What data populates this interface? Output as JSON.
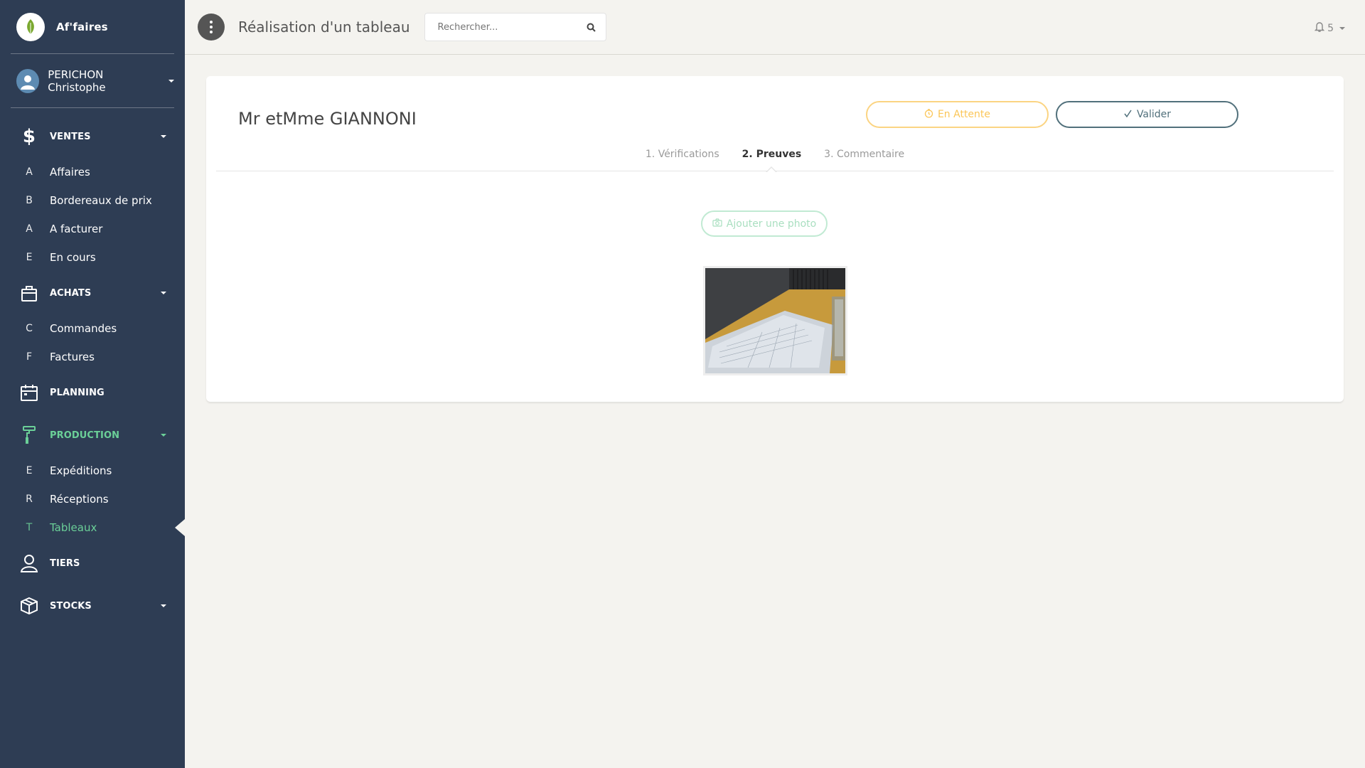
{
  "brand": {
    "name": "Af'faires"
  },
  "user": {
    "name": "PERICHON Christophe"
  },
  "nav": {
    "ventes": {
      "label": "VENTES",
      "items": [
        {
          "mini": "A",
          "label": "Affaires"
        },
        {
          "mini": "B",
          "label": "Bordereaux de prix"
        },
        {
          "mini": "A",
          "label": "A facturer"
        },
        {
          "mini": "E",
          "label": "En cours"
        }
      ]
    },
    "achats": {
      "label": "ACHATS",
      "items": [
        {
          "mini": "C",
          "label": "Commandes"
        },
        {
          "mini": "F",
          "label": "Factures"
        }
      ]
    },
    "planning": {
      "label": "PLANNING"
    },
    "production": {
      "label": "PRODUCTION",
      "items": [
        {
          "mini": "E",
          "label": "Expéditions"
        },
        {
          "mini": "R",
          "label": "Réceptions"
        },
        {
          "mini": "T",
          "label": "Tableaux"
        }
      ]
    },
    "tiers": {
      "label": "TIERS"
    },
    "stocks": {
      "label": "STOCKS"
    }
  },
  "topbar": {
    "title": "Réalisation d'un tableau",
    "search_placeholder": "Rechercher...",
    "notifications": "5"
  },
  "card": {
    "client": "Mr etMme GIANNONI",
    "btn_wait": "En Attente",
    "btn_validate": "Valider",
    "tabs": [
      {
        "label": "1. Vérifications"
      },
      {
        "label": "2. Preuves"
      },
      {
        "label": "3. Commentaire"
      }
    ],
    "btn_photo": "Ajouter une photo"
  },
  "colors": {
    "sidebar": "#2e3d54",
    "active": "#6bd098",
    "warning": "#fbc658",
    "primary": "#51707b"
  }
}
